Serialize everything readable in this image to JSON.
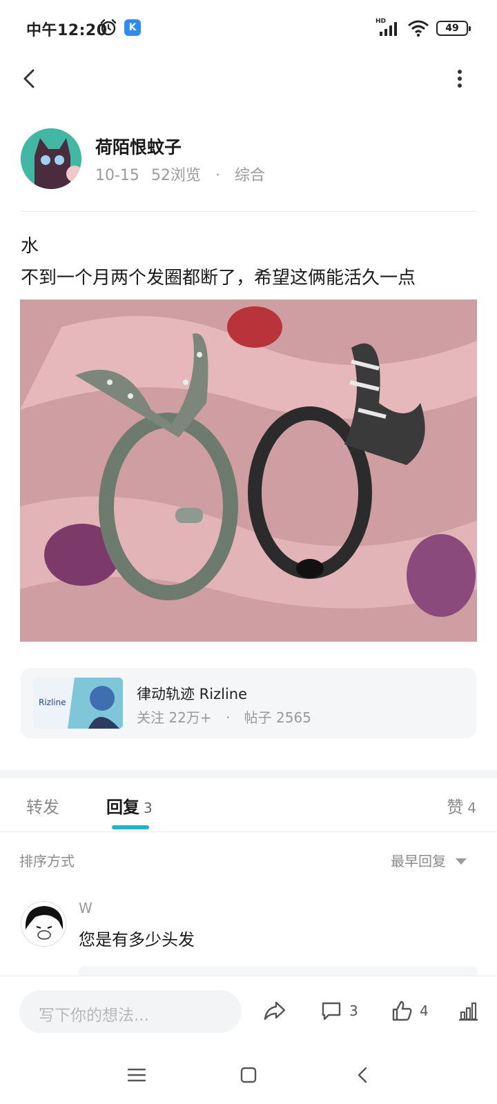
{
  "status_bar": {
    "time": "中午12:20",
    "battery": "49",
    "hd_label": "HD",
    "app_badge": "K"
  },
  "nav": {
    "back_icon": "chevron-left-icon",
    "more_icon": "vertical-dots-icon"
  },
  "author": {
    "name": "荷陌恨蚊子",
    "date": "10-15",
    "views": "52浏览",
    "separator": "·",
    "category": "综合"
  },
  "post": {
    "title": "水",
    "body": "不到一个月两个发圈都断了，希望这俩能活久一点"
  },
  "game_card": {
    "logo_text": "Rizline",
    "name": "律动轨迹 Rizline",
    "followers": "关注 22万+",
    "separator": "·",
    "posts": "帖子 2565"
  },
  "tabs": {
    "forward": "转发",
    "reply_label": "回复",
    "reply_count": "3",
    "like_label": "赞",
    "like_count": "4",
    "accent": "#1fb4c8"
  },
  "sort": {
    "label": "排序方式",
    "value": "最早回复"
  },
  "comments": [
    {
      "user": "W",
      "text": "您是有多少头发"
    }
  ],
  "bottom_bar": {
    "placeholder": "写下你的想法...",
    "comment_count": "3",
    "like_count": "4"
  }
}
